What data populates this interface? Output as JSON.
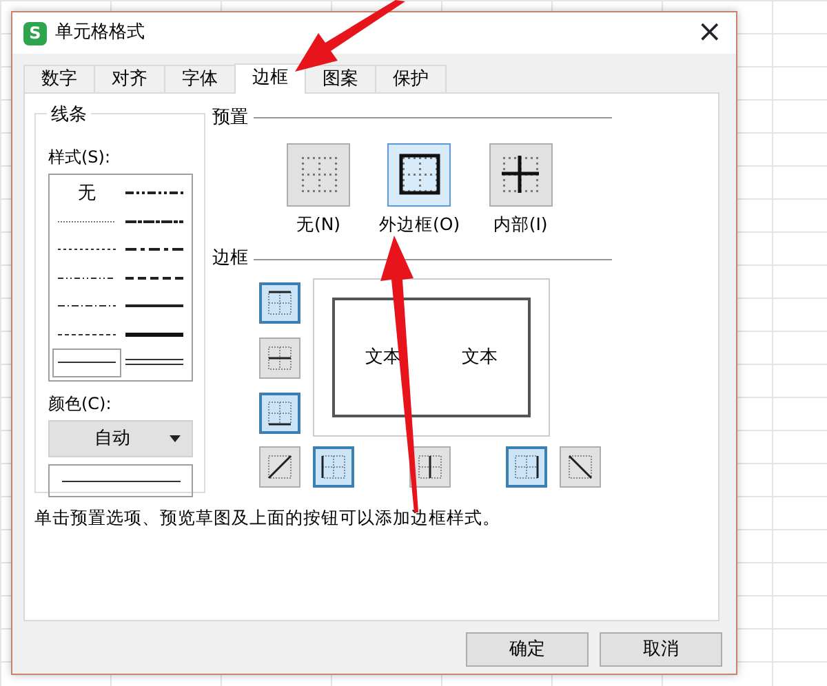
{
  "window": {
    "title": "单元格格式",
    "app_icon": "S",
    "close": "×"
  },
  "tabs": [
    {
      "label": "数字",
      "selected": false
    },
    {
      "label": "对齐",
      "selected": false
    },
    {
      "label": "字体",
      "selected": false
    },
    {
      "label": "边框",
      "selected": true
    },
    {
      "label": "图案",
      "selected": false
    },
    {
      "label": "保护",
      "selected": false
    }
  ],
  "line_group": {
    "title": "线条",
    "style_label": "样式(S):",
    "color_label": "颜色(C):",
    "color_value": "自动",
    "styles": [
      {
        "kind": "none",
        "label": "无",
        "selected": false
      },
      {
        "kind": "medium_dash_dot_dot",
        "selected": false
      },
      {
        "kind": "hair",
        "selected": false
      },
      {
        "kind": "slanted_dash_dot",
        "selected": false
      },
      {
        "kind": "dotted",
        "selected": false
      },
      {
        "kind": "medium_dash_dot",
        "selected": false
      },
      {
        "kind": "dash_dot_dot",
        "selected": false
      },
      {
        "kind": "medium_dashed",
        "selected": false
      },
      {
        "kind": "dash_dot",
        "selected": false
      },
      {
        "kind": "medium",
        "selected": false
      },
      {
        "kind": "dashed",
        "selected": false
      },
      {
        "kind": "thick",
        "selected": false
      },
      {
        "kind": "thin",
        "selected": true
      },
      {
        "kind": "double",
        "selected": false
      }
    ]
  },
  "presets": {
    "title": "预置",
    "items": [
      {
        "kind": "none",
        "label": "无(N)",
        "selected": false
      },
      {
        "kind": "outline",
        "label": "外边框(O)",
        "selected": true
      },
      {
        "kind": "inside",
        "label": "内部(I)",
        "selected": false
      }
    ]
  },
  "border": {
    "title": "边框",
    "toggles": [
      {
        "kind": "top",
        "on": true
      },
      {
        "kind": "middle",
        "on": false
      },
      {
        "kind": "bottom",
        "on": true
      },
      {
        "kind": "diag_up",
        "on": false
      },
      {
        "kind": "left",
        "on": true
      },
      {
        "kind": "center",
        "on": false
      },
      {
        "kind": "right",
        "on": true
      },
      {
        "kind": "diag_down",
        "on": false
      }
    ],
    "preview_texts": [
      "文本",
      "文本"
    ]
  },
  "hint": "单击预置选项、预览草图及上面的按钮可以添加边框样式。",
  "buttons": [
    "确定",
    "取消"
  ]
}
